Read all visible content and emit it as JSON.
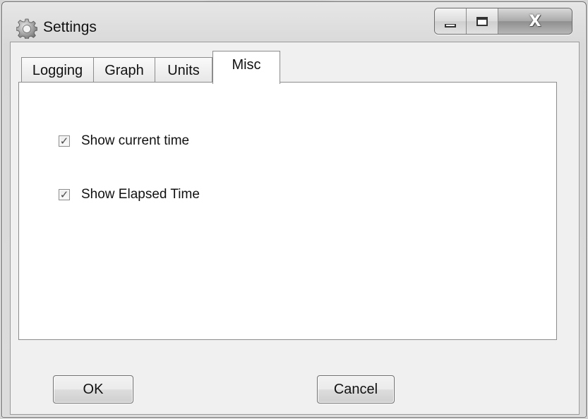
{
  "window": {
    "title": "Settings"
  },
  "caption_buttons": {
    "minimize_icon": "minimize-icon",
    "maximize_icon": "maximize-icon",
    "close_glyph": "X"
  },
  "tabs": [
    {
      "label": "Logging",
      "active": false
    },
    {
      "label": "Graph",
      "active": false
    },
    {
      "label": "Units",
      "active": false
    },
    {
      "label": "Misc",
      "active": true
    }
  ],
  "misc_panel": {
    "options": [
      {
        "label": "Show current time",
        "checked": true
      },
      {
        "label": "Show Elapsed Time",
        "checked": true
      }
    ]
  },
  "footer": {
    "ok_label": "OK",
    "cancel_label": "Cancel"
  },
  "colors": {
    "window_bg": "#dcdcdc",
    "client_bg": "#f0f0f0",
    "panel_bg": "#ffffff",
    "border": "#8c8c8c"
  }
}
